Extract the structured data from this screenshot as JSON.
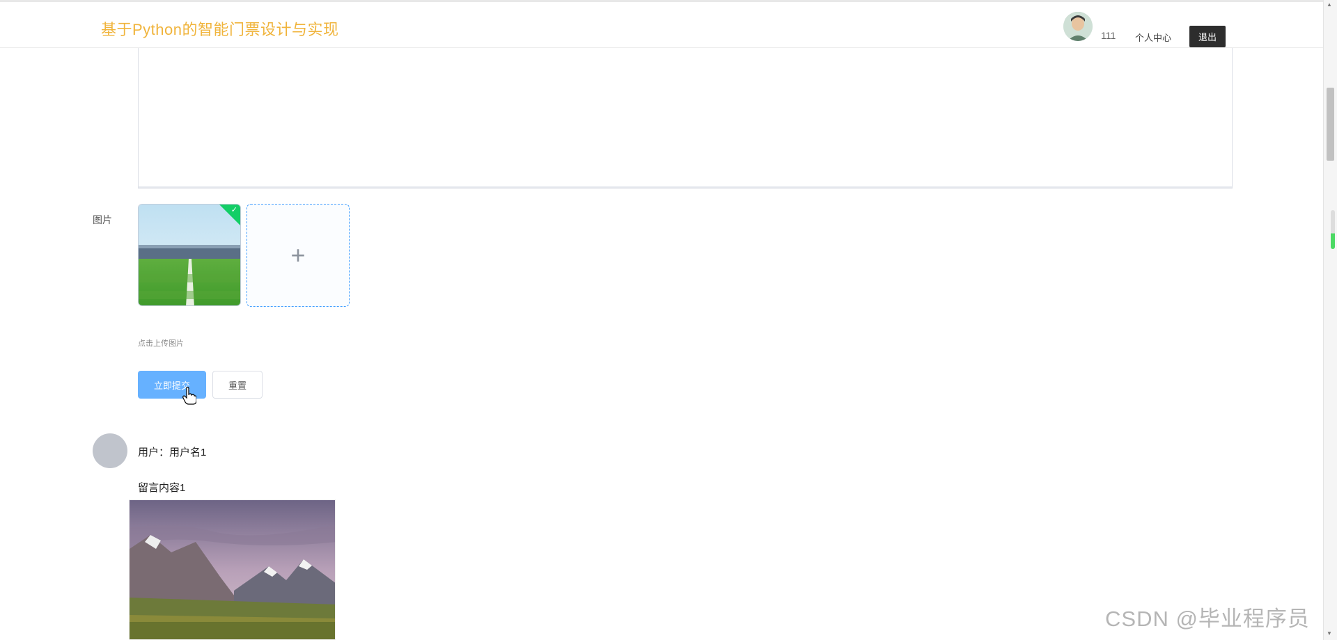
{
  "header": {
    "site_title": "基于Python的智能门票设计与实现",
    "user_id": "111",
    "personal_center": "个人中心",
    "logout_label": "退出"
  },
  "form": {
    "textarea_value": "",
    "image_label": "图片",
    "upload_tip": "点击上传图片",
    "submit_label": "立即提交",
    "reset_label": "重置",
    "upload_status": "success"
  },
  "comment": {
    "user_line": "用户：用户名1",
    "content": "留言内容1"
  },
  "watermark": "CSDN @毕业程序员",
  "colors": {
    "title": "#f0b43c",
    "primary_light": "#66b1ff",
    "success": "#13ce66",
    "logout_bg": "#2d2d2d"
  },
  "icons": {
    "plus": "plus-icon",
    "check": "check-icon",
    "cursor": "hand-cursor-icon"
  }
}
